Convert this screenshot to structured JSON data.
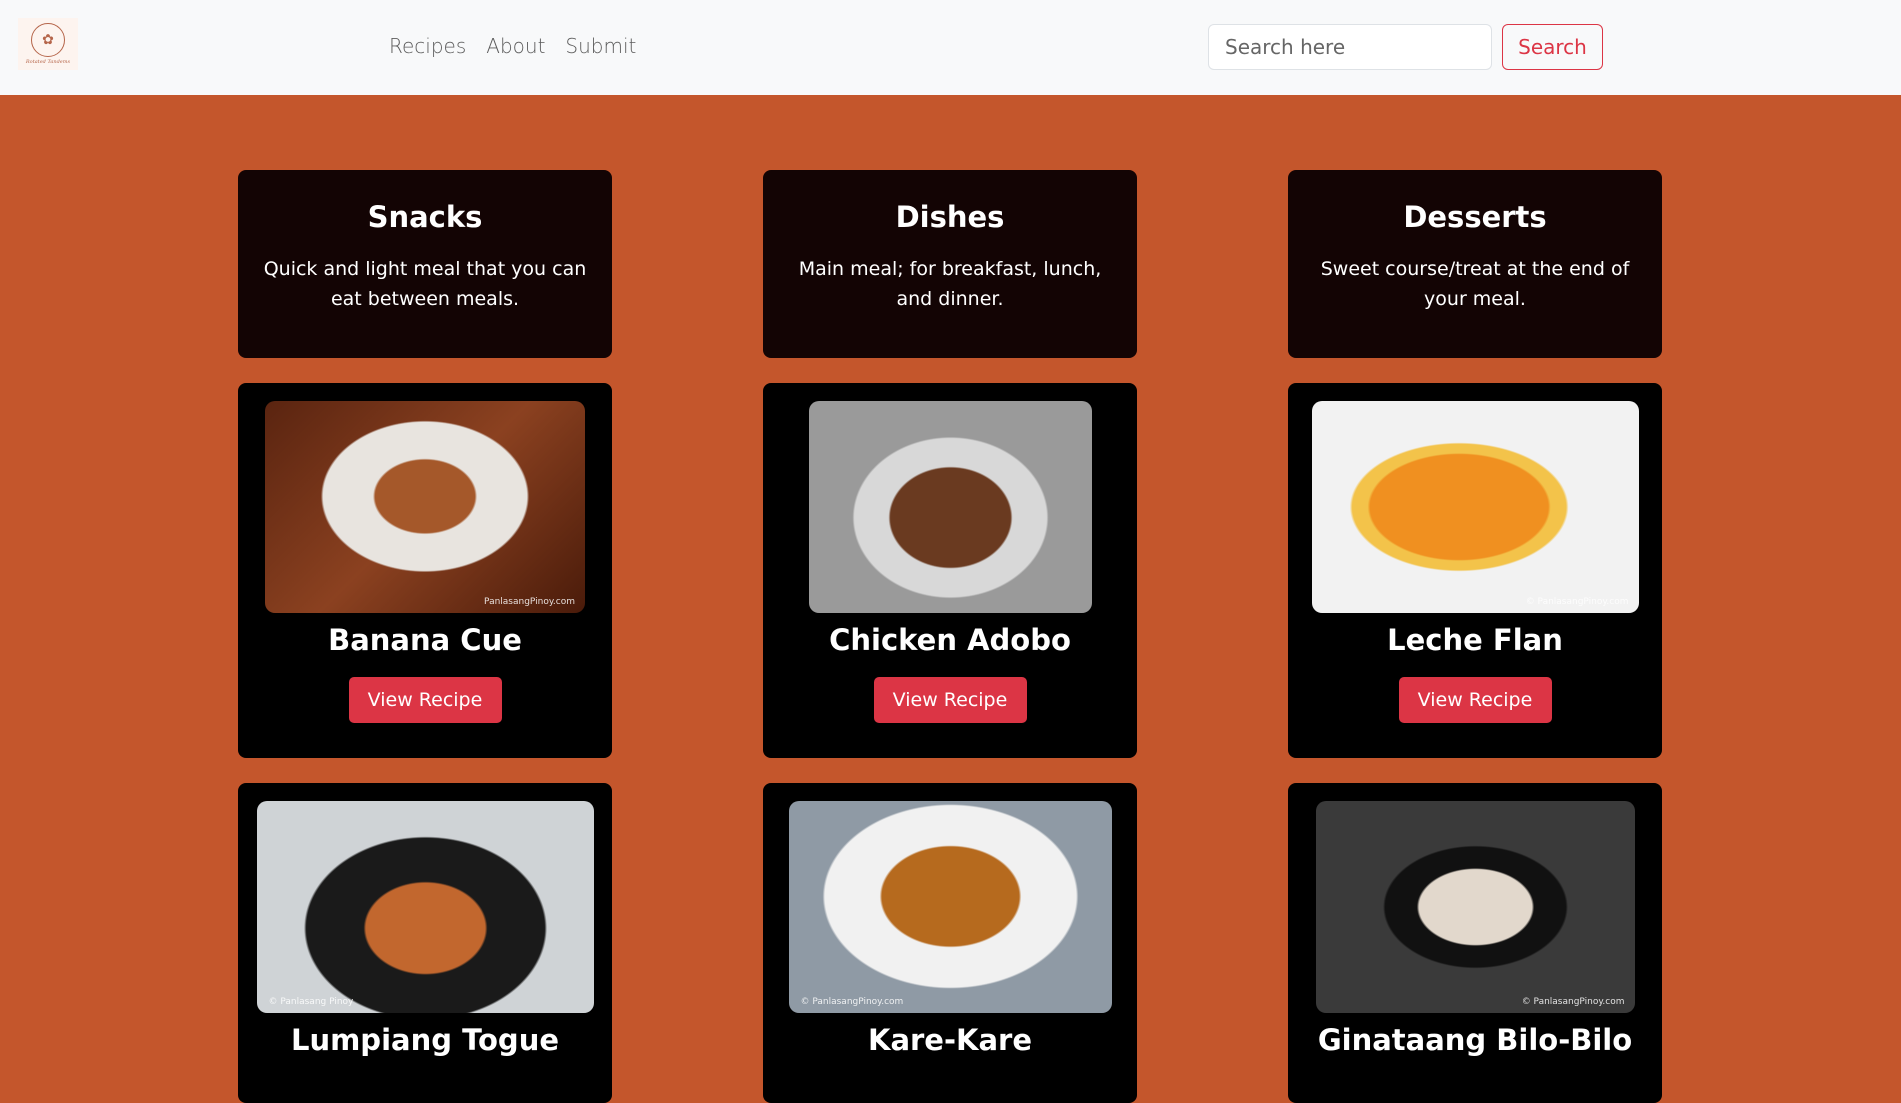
{
  "header": {
    "logo_text": "Rotated Tandems",
    "nav": [
      "Recipes",
      "About",
      "Submit"
    ],
    "search_placeholder": "Search here",
    "search_button": "Search"
  },
  "categories": [
    {
      "title": "Snacks",
      "description": "Quick and light meal that you can eat between meals."
    },
    {
      "title": "Dishes",
      "description": "Main meal; for breakfast, lunch, and dinner."
    },
    {
      "title": "Desserts",
      "description": "Sweet course/treat at the end of your meal."
    }
  ],
  "recipes": [
    {
      "name": "Banana Cue",
      "button": "View Recipe",
      "watermark": "PanlasangPinoy.com"
    },
    {
      "name": "Chicken Adobo",
      "button": "View Recipe",
      "watermark": ""
    },
    {
      "name": "Leche Flan",
      "button": "View Recipe",
      "watermark": "© PanlasangPinoy.com"
    },
    {
      "name": "Lumpiang Togue",
      "watermark": "© Panlasang Pinoy"
    },
    {
      "name": "Kare-Kare",
      "watermark": "© PanlasangPinoy.com"
    },
    {
      "name": "Ginataang Bilo-Bilo",
      "watermark": "© PanlasangPinoy.com"
    }
  ],
  "colors": {
    "background": "#c4562c",
    "accent": "#dc3545"
  }
}
